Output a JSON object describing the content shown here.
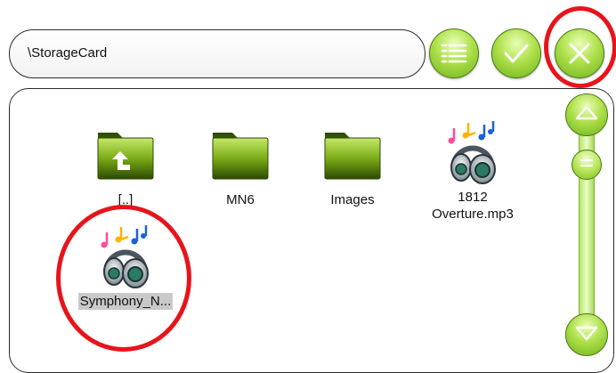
{
  "path_bar": {
    "path": "\\StorageCard"
  },
  "toolbar": {
    "list_view_icon": "list-icon",
    "confirm_icon": "check-icon",
    "close_icon": "close-icon"
  },
  "files": [
    {
      "label": "[..]",
      "icon": "folder-up-icon",
      "selected": false
    },
    {
      "label": "MN6",
      "icon": "folder-icon",
      "selected": false
    },
    {
      "label": "Images",
      "icon": "folder-icon",
      "selected": false
    },
    {
      "label_line1": "1812",
      "label_line2": "Overture.mp3",
      "icon": "music-file-icon",
      "selected": false
    },
    {
      "label": "Symphony_N...",
      "icon": "music-file-icon",
      "selected": true
    }
  ],
  "scrollbar": {
    "up_icon": "triangle-up-icon",
    "down_icon": "triangle-down-icon",
    "thumb_icon": "grip-icon"
  },
  "colors": {
    "accent_green": "#8fcc2e",
    "highlight_red": "#e8141b",
    "selection_gray": "#c9c9c9",
    "folder_dark": "#3a5a06"
  }
}
